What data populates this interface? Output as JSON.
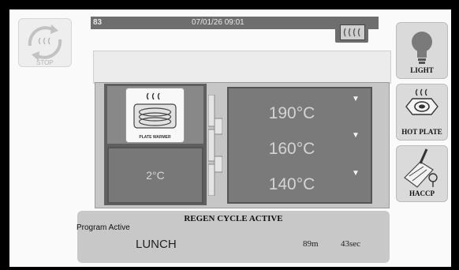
{
  "status_bar": {
    "slot_label": "83",
    "datetime": "07/01/26 09:01"
  },
  "buttons": {
    "stop_label": "STOP",
    "light_label": "LIGHT",
    "hot_plate_label": "HOT PLATE",
    "haccp_label": "HACCP"
  },
  "oven": {
    "plate_warmer_label": "PLATE WARMER",
    "cold_zone_temp": "2°C",
    "temps": [
      "190°C",
      "160°C",
      "140°C"
    ]
  },
  "banner": {
    "title": "REGEN CYCLE ACTIVE",
    "program_label": "Program Active",
    "program_name": "LUNCH",
    "remaining_min": "89m",
    "remaining_sec": "43sec"
  },
  "icons": {
    "stop": "stop-cycle-icon",
    "light": "lightbulb-icon",
    "hot_plate": "hot-plate-icon",
    "haccp": "haccp-probe-icon",
    "heater": "heater-icon"
  }
}
